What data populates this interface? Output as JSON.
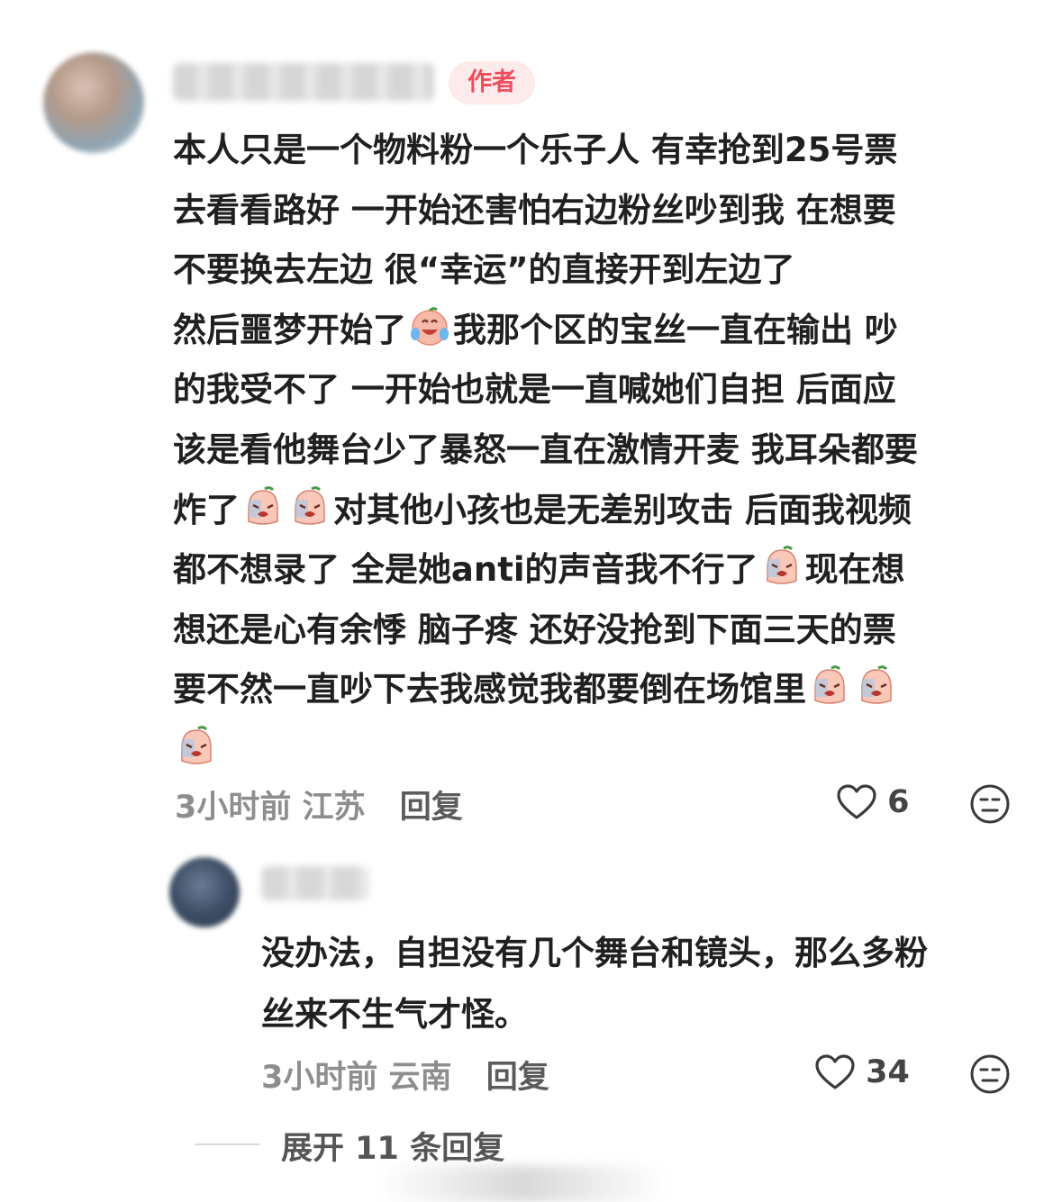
{
  "comment": {
    "author_badge": "作者",
    "lines": [
      "本人只是一个物料粉一个乐子人 有幸抢到25号票",
      "去看看路好 一开始还害怕右边粉丝吵到我 在想要",
      "不要换去左边 很“幸运”的直接开到左边了"
    ],
    "line4_a": "然后噩梦开始了",
    "line4_b": "我那个区的宝丝一直在输出 吵",
    "line5": "的我受不了 一开始也就是一直喊她们自担 后面应",
    "line6": "该是看他舞台少了暴怒一直在激情开麦 我耳朵都要",
    "line7_a": "炸了",
    "line7_b": "对其他小孩也是无差别攻击 后面我视频",
    "line8_a": "都不想录了 全是她anti的声音我不行了",
    "line8_b": "现在想",
    "line9": "想还是心有余悸 脑子疼 还好没抢到下面三天的票",
    "line10": "要不然一直吵下去我感觉我都要倒在场馆里",
    "time": "3小时前",
    "location": "江苏",
    "reply_label": "回复",
    "likes": "6"
  },
  "reply": {
    "lines": [
      "没办法，自担没有几个舞台和镜头，那么多粉",
      "丝来不生气才怪。"
    ],
    "time": "3小时前",
    "location": "云南",
    "reply_label": "回复",
    "likes": "34"
  },
  "expand_label": "展开 11 条回复",
  "icons": {
    "like": "heart-outline-icon",
    "dislike": "neutral-face-icon",
    "emoji_laugh_cry": "laugh-cry-emoji-icon",
    "emoji_cry": "crying-emoji-icon"
  },
  "colors": {
    "badge_text": "#ef4d5d",
    "badge_bg": "#fdeaea",
    "meta_text": "#8e8e8e"
  }
}
